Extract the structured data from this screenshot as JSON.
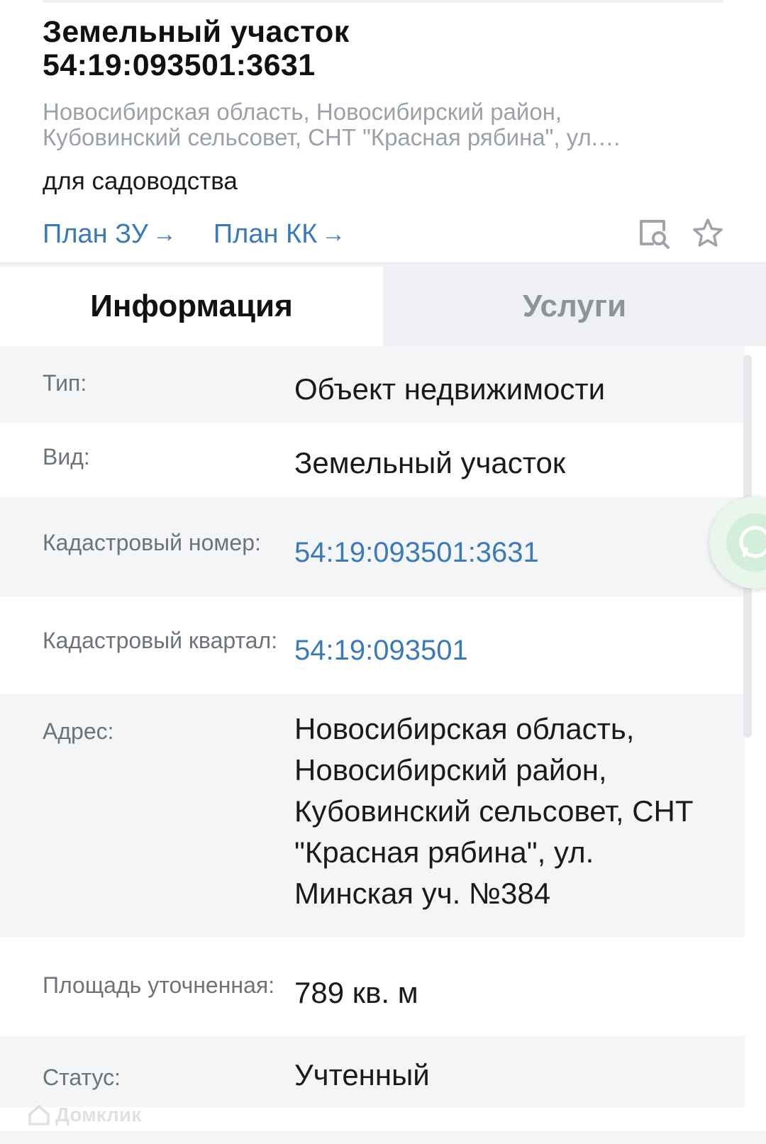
{
  "header": {
    "title": "Земельный участок 54:19:093501:3631",
    "address_short": "Новосибирская область, Новосибирский район, Кубовинский сельсовет, СНТ \"Красная рябина\", ул. Минская уч. №384",
    "purpose": "для садоводства",
    "links": [
      {
        "label": "План ЗУ",
        "arrow": "→"
      },
      {
        "label": "План КК",
        "arrow": "→"
      }
    ],
    "icons": [
      "map-search-icon",
      "star-icon"
    ]
  },
  "tabs": [
    {
      "label": "Информация",
      "active": true
    },
    {
      "label": "Услуги",
      "active": false
    }
  ],
  "info": {
    "type": {
      "label": "Тип:",
      "value": "Объект недвижимости"
    },
    "kind": {
      "label": "Вид:",
      "value": "Земельный участок"
    },
    "cadastral_number": {
      "label": "Кадастровый номер:",
      "value": "54:19:093501:3631"
    },
    "cadastral_quarter": {
      "label": "Кадастровый квартал:",
      "value": "54:19:093501"
    },
    "address": {
      "label": "Адрес:",
      "value": "Новосибирская область, Новосибирский район, Кубовинский сельсовет, СНТ \"Красная рябина\", ул. Минская уч. №384"
    },
    "area": {
      "label": "Площадь уточненная:",
      "value": "789 кв. м"
    },
    "status": {
      "label": "Статус:",
      "value": "Учтенный"
    }
  },
  "watermark": {
    "logo": "domclick-logo",
    "text": "Домклик"
  },
  "floating": {
    "icon": "whatsapp-icon"
  },
  "colors": {
    "link": "#3a7ab8",
    "muted": "#9aa1a8",
    "row_alt": "#f4f5f7",
    "tab_inactive_bg": "#eef0f3",
    "whatsapp": "#25d366"
  }
}
